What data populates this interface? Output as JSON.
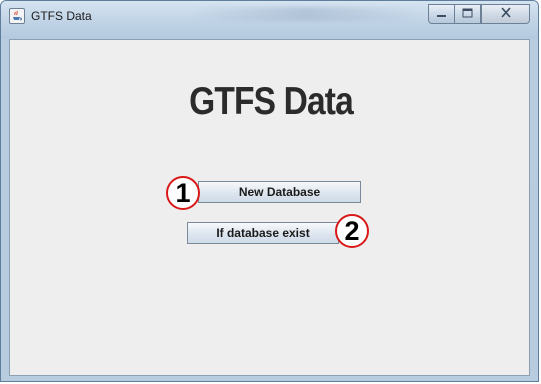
{
  "window": {
    "title": "GTFS Data"
  },
  "main": {
    "heading": "GTFS Data",
    "buttons": {
      "new_database": "New Database",
      "if_database_exist": "If database exist"
    },
    "annotations": {
      "marker_1": "1",
      "marker_2": "2"
    }
  },
  "icons": {
    "app": "java-app-icon",
    "minimize": "minimize-icon",
    "maximize": "maximize-icon",
    "close": "close-icon"
  },
  "colors": {
    "annotation_ring": "#d91818",
    "client_background": "#eeeeee",
    "heading_text": "#2b2b2b"
  }
}
